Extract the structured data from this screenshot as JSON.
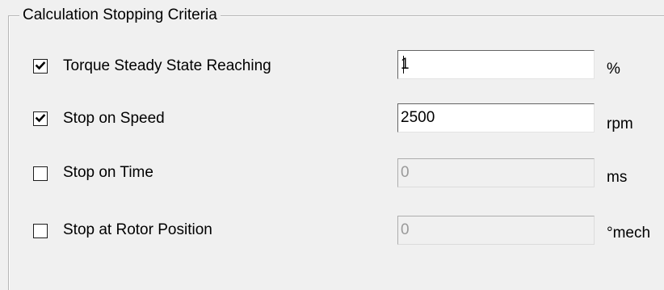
{
  "group": {
    "title": "Calculation Stopping Criteria"
  },
  "criteria": [
    {
      "label": "Torque Steady State Reaching",
      "checked": true,
      "value": "1",
      "unit": "%",
      "enabled": true
    },
    {
      "label": "Stop on Speed",
      "checked": true,
      "value": "2500",
      "unit": "rpm",
      "enabled": true
    },
    {
      "label": "Stop on Time",
      "checked": false,
      "value": "0",
      "unit": "ms",
      "enabled": false
    },
    {
      "label": "Stop at Rotor Position",
      "checked": false,
      "value": "0",
      "unit": "°mech",
      "enabled": false
    }
  ],
  "colors": {
    "background": "#f0f0f0",
    "groupbox_border": "#b6b6b6",
    "textbox_enabled_bg": "#ffffff",
    "textbox_disabled_bg": "#f0f0f0",
    "disabled_text": "#9a9a9a"
  }
}
